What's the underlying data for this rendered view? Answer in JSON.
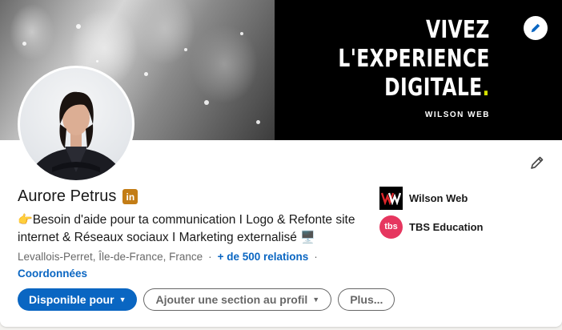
{
  "banner": {
    "lines": [
      "VIVEZ",
      "L'EXPERIENCE",
      "DIGITALE"
    ],
    "dot": ".",
    "brand": "WILSON WEB",
    "accent_color": "#d4e000"
  },
  "profile": {
    "name": "Aurore Petrus",
    "badge": "in",
    "headline_emoji": "👉",
    "headline": "Besoin d'aide pour ta communication I Logo & Refonte site internet & Réseaux sociaux I Marketing externalisé",
    "headline_end_emoji": "🖥️",
    "location": "Levallois-Perret, Île-de-France, France",
    "separator": "·",
    "relations": "+ de 500 relations",
    "contact": "Coordonnées"
  },
  "actions": {
    "primary": "Disponible pour",
    "add_section": "Ajouter une section au profil",
    "more": "Plus..."
  },
  "organizations": [
    {
      "name": "Wilson Web",
      "icon": "wilson-web-logo"
    },
    {
      "name": "TBS Education",
      "icon": "tbs-logo",
      "logo_text": "tbs"
    }
  ],
  "colors": {
    "link": "#0a66c2",
    "primary_button": "#0a66c2",
    "badge": "#c37d16",
    "tbs": "#e6365f"
  }
}
